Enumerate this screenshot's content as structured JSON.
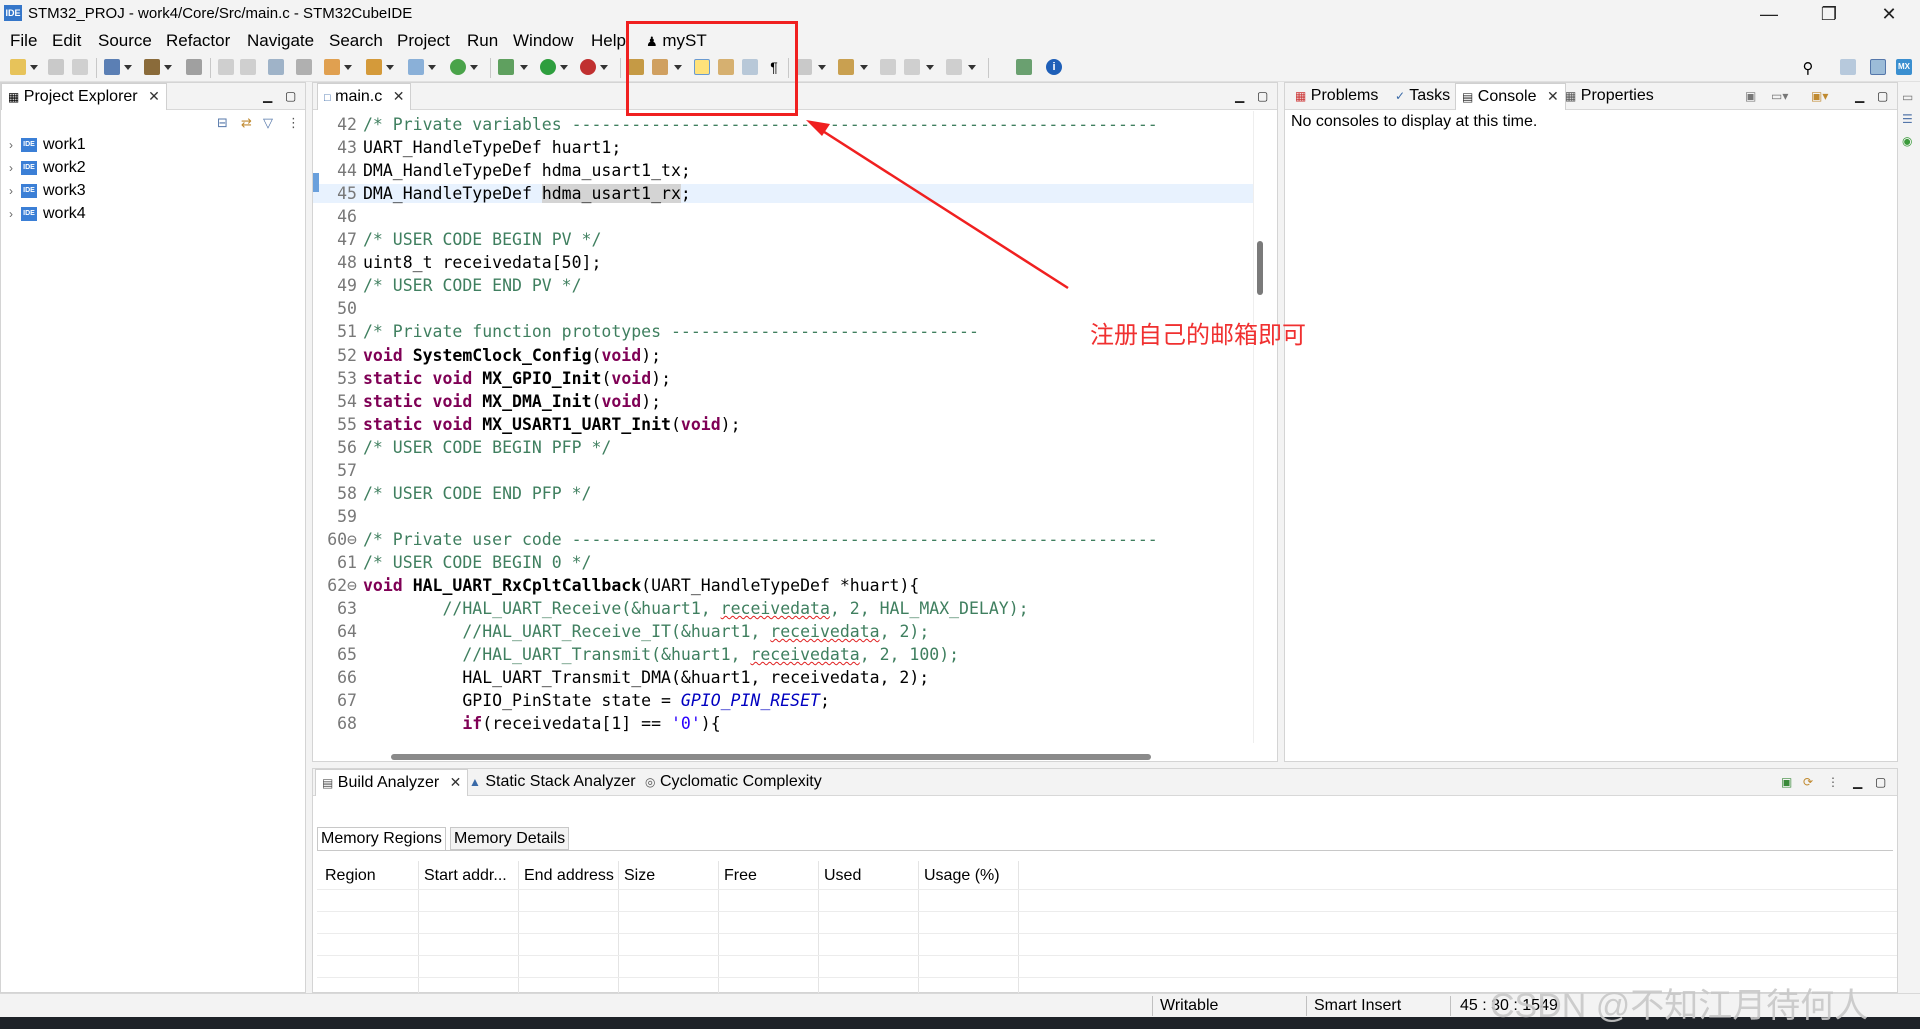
{
  "window": {
    "title": "STM32_PROJ - work4/Core/Src/main.c - STM32CubeIDE",
    "logo": "IDE",
    "minimize": "—",
    "restore": "❐",
    "close": "✕"
  },
  "menu": {
    "items": [
      "File",
      "Edit",
      "Source",
      "Refactor",
      "Navigate",
      "Search",
      "Project",
      "Run",
      "Window",
      "Help"
    ],
    "myst_label": "myST"
  },
  "project_explorer": {
    "title": "Project Explorer",
    "items": [
      "work1",
      "work2",
      "work3",
      "work4"
    ],
    "ide_badge": "IDE"
  },
  "editor": {
    "tab_label": "main.c",
    "lines": [
      {
        "n": "42",
        "parts": [
          {
            "c": "cmt",
            "t": "/* Private variables -----------------------------------------------------------"
          }
        ]
      },
      {
        "n": "43",
        "parts": [
          {
            "c": "",
            "t": "UART_HandleTypeDef huart1;"
          }
        ]
      },
      {
        "n": "44",
        "parts": [
          {
            "c": "",
            "t": "DMA_HandleTypeDef hdma_usart1_tx;"
          }
        ]
      },
      {
        "n": "45",
        "hl": true,
        "parts": [
          {
            "c": "",
            "t": "DMA_HandleTypeDef "
          },
          {
            "c": "sel",
            "t": "hdma_usart1_rx"
          },
          {
            "c": "",
            "t": ";"
          }
        ]
      },
      {
        "n": "46",
        "parts": [
          {
            "c": "",
            "t": ""
          }
        ]
      },
      {
        "n": "47",
        "parts": [
          {
            "c": "cmt",
            "t": "/* USER CODE BEGIN PV */"
          }
        ]
      },
      {
        "n": "48",
        "parts": [
          {
            "c": "",
            "t": "uint8_t receivedata[50];"
          }
        ]
      },
      {
        "n": "49",
        "parts": [
          {
            "c": "cmt",
            "t": "/* USER CODE END PV */"
          }
        ]
      },
      {
        "n": "50",
        "parts": [
          {
            "c": "",
            "t": ""
          }
        ]
      },
      {
        "n": "51",
        "parts": [
          {
            "c": "cmt",
            "t": "/* Private function prototypes -------------------------------"
          }
        ]
      },
      {
        "n": "52",
        "parts": [
          {
            "c": "kw",
            "t": "void"
          },
          {
            "c": "",
            "t": " "
          },
          {
            "c": "fn",
            "t": "SystemClock_Config"
          },
          {
            "c": "",
            "t": "("
          },
          {
            "c": "kw",
            "t": "void"
          },
          {
            "c": "",
            "t": ");"
          }
        ]
      },
      {
        "n": "53",
        "parts": [
          {
            "c": "kw",
            "t": "static"
          },
          {
            "c": "",
            "t": " "
          },
          {
            "c": "kw",
            "t": "void"
          },
          {
            "c": "",
            "t": " "
          },
          {
            "c": "fn",
            "t": "MX_GPIO_Init"
          },
          {
            "c": "",
            "t": "("
          },
          {
            "c": "kw",
            "t": "void"
          },
          {
            "c": "",
            "t": ");"
          }
        ]
      },
      {
        "n": "54",
        "parts": [
          {
            "c": "kw",
            "t": "static"
          },
          {
            "c": "",
            "t": " "
          },
          {
            "c": "kw",
            "t": "void"
          },
          {
            "c": "",
            "t": " "
          },
          {
            "c": "fn",
            "t": "MX_DMA_Init"
          },
          {
            "c": "",
            "t": "("
          },
          {
            "c": "kw",
            "t": "void"
          },
          {
            "c": "",
            "t": ");"
          }
        ]
      },
      {
        "n": "55",
        "parts": [
          {
            "c": "kw",
            "t": "static"
          },
          {
            "c": "",
            "t": " "
          },
          {
            "c": "kw",
            "t": "void"
          },
          {
            "c": "",
            "t": " "
          },
          {
            "c": "fn",
            "t": "MX_USART1_UART_Init"
          },
          {
            "c": "",
            "t": "("
          },
          {
            "c": "kw",
            "t": "void"
          },
          {
            "c": "",
            "t": ");"
          }
        ]
      },
      {
        "n": "56",
        "parts": [
          {
            "c": "cmt",
            "t": "/* USER CODE BEGIN PFP */"
          }
        ]
      },
      {
        "n": "57",
        "parts": [
          {
            "c": "",
            "t": ""
          }
        ]
      },
      {
        "n": "58",
        "parts": [
          {
            "c": "cmt",
            "t": "/* USER CODE END PFP */"
          }
        ]
      },
      {
        "n": "59",
        "parts": [
          {
            "c": "",
            "t": ""
          }
        ]
      },
      {
        "n": "60⊖",
        "parts": [
          {
            "c": "cmt",
            "t": "/* Private user code -----------------------------------------------------------"
          }
        ]
      },
      {
        "n": "61",
        "parts": [
          {
            "c": "cmt",
            "t": "/* USER CODE BEGIN 0 */"
          }
        ]
      },
      {
        "n": "62⊖",
        "parts": [
          {
            "c": "kw",
            "t": "void"
          },
          {
            "c": "",
            "t": " "
          },
          {
            "c": "fn",
            "t": "HAL_UART_RxCpltCallback"
          },
          {
            "c": "",
            "t": "(UART_HandleTypeDef *huart){"
          }
        ]
      },
      {
        "n": "63",
        "parts": [
          {
            "c": "",
            "t": "        "
          },
          {
            "c": "cmt",
            "t": "//HAL_UART_Receive(&huart1, "
          },
          {
            "c": "cmt squig",
            "t": "receivedata"
          },
          {
            "c": "cmt",
            "t": ", 2, HAL_MAX_DELAY);"
          }
        ]
      },
      {
        "n": "64",
        "parts": [
          {
            "c": "",
            "t": "          "
          },
          {
            "c": "cmt",
            "t": "//HAL_UART_Receive_IT(&huart1, "
          },
          {
            "c": "cmt squig",
            "t": "receivedata"
          },
          {
            "c": "cmt",
            "t": ", 2);"
          }
        ]
      },
      {
        "n": "65",
        "parts": [
          {
            "c": "",
            "t": "          "
          },
          {
            "c": "cmt",
            "t": "//HAL_UART_Transmit(&huart1, "
          },
          {
            "c": "cmt squig",
            "t": "receivedata"
          },
          {
            "c": "cmt",
            "t": ", 2, 100);"
          }
        ]
      },
      {
        "n": "66",
        "parts": [
          {
            "c": "",
            "t": "          HAL_UART_Transmit_DMA(&huart1, receivedata, 2);"
          }
        ]
      },
      {
        "n": "67",
        "parts": [
          {
            "c": "",
            "t": "          GPIO_PinState state = "
          },
          {
            "c": "mac",
            "t": "GPIO_PIN_RESET"
          },
          {
            "c": "",
            "t": ";"
          }
        ]
      },
      {
        "n": "68",
        "parts": [
          {
            "c": "",
            "t": "          "
          },
          {
            "c": "kw",
            "t": "if"
          },
          {
            "c": "",
            "t": "(receivedata[1] == "
          },
          {
            "c": "str",
            "t": "'0'"
          },
          {
            "c": "",
            "t": "){"
          }
        ]
      }
    ]
  },
  "right_panel": {
    "tabs": [
      "Problems",
      "Tasks",
      "Console",
      "Properties"
    ],
    "console_message": "No consoles to display at this time."
  },
  "bottom_panel": {
    "tabs": [
      "Build Analyzer",
      "Static Stack Analyzer",
      "Cyclomatic Complexity"
    ],
    "subtabs": [
      "Memory Regions",
      "Memory Details"
    ],
    "columns": [
      "Region",
      "Start addr...",
      "End address",
      "Size",
      "Free",
      "Used",
      "Usage (%)"
    ]
  },
  "status": {
    "mode": "Writable",
    "insert": "Smart Insert",
    "position": "45 : 30 : 1549"
  },
  "annotation": {
    "text": "注册自己的邮箱即可"
  },
  "watermark": "CSDN @不知江月待何人",
  "colors": {
    "annotation_red": "#f02020",
    "comment_green": "#3f7f5f",
    "keyword_purple": "#7f0055",
    "macro_blue": "#0000c0"
  }
}
